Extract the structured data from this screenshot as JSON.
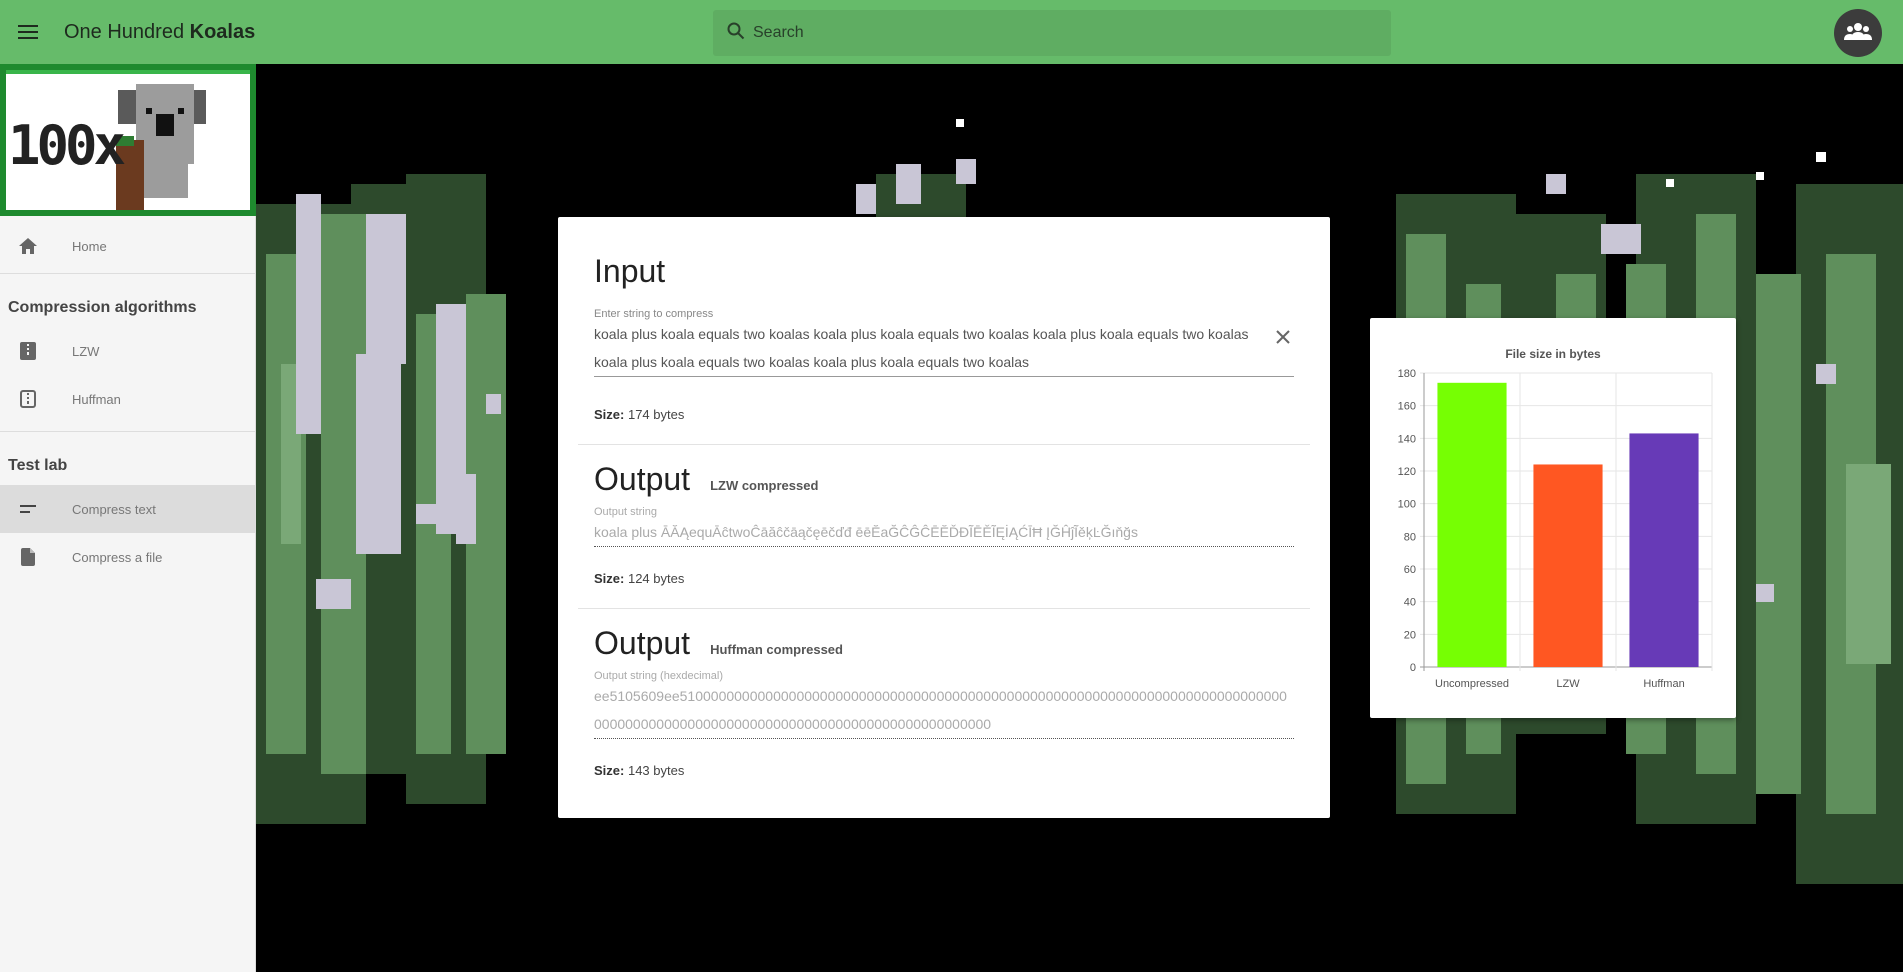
{
  "header": {
    "title_prefix": "One Hundred",
    "title_bold": "Koalas",
    "search_placeholder": "Search"
  },
  "sidebar": {
    "logo_text": "100x",
    "home": "Home",
    "section1": "Compression algorithms",
    "lzw": "LZW",
    "huffman": "Huffman",
    "section2": "Test lab",
    "compress_text": "Compress text",
    "compress_file": "Compress a file"
  },
  "input": {
    "title": "Input",
    "label": "Enter string to compress",
    "value": "koala plus koala equals two koalas koala plus koala equals two koalas koala plus koala equals two koalas koala plus koala equals two koalas koala plus koala equals two koalas",
    "size_label": "Size:",
    "size_value": "174 bytes"
  },
  "lzw_output": {
    "title": "Output",
    "subtitle": "LZW compressed",
    "label": "Output string",
    "value": "koala plus ĀĂĄequĀĉtwoĈāăĉčāąčęēčďđ ēēĔaĞĈĜĈĒĔĎĐĨĒĚĨĘİĄĆĪĦ ĮĞĤĵĨěķĿĞıňğs",
    "size_label": "Size:",
    "size_value": "124 bytes"
  },
  "huffman_output": {
    "title": "Output",
    "subtitle": "Huffman compressed",
    "label": "Output string (hexdecimal)",
    "value": "ee5105609ee510000000000000000000000000000000000000000000000000000000000000000000000000000000000000000000000000000000000000000000000000000000",
    "size_label": "Size:",
    "size_value": "143 bytes"
  },
  "chart_data": {
    "type": "bar",
    "title": "File size in bytes",
    "categories": [
      "Uncompressed",
      "LZW",
      "Huffman"
    ],
    "values": [
      174,
      124,
      143
    ],
    "colors": [
      "#76ff03",
      "#ff5722",
      "#673ab7"
    ],
    "ylim": [
      0,
      180
    ],
    "yticks": [
      0,
      20,
      40,
      60,
      80,
      100,
      120,
      140,
      160,
      180
    ],
    "grid": true
  }
}
